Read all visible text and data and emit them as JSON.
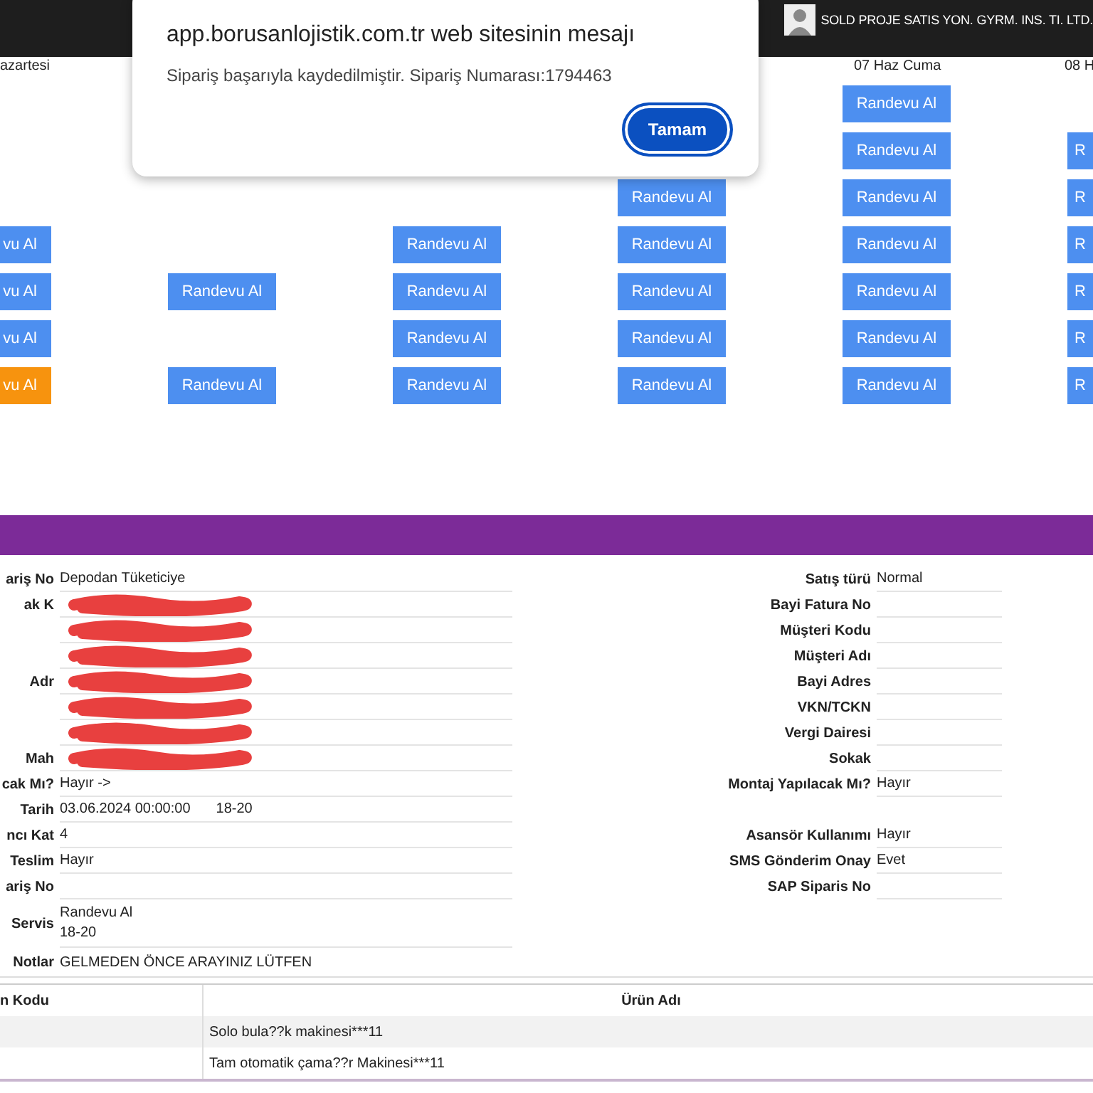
{
  "top_bar": {
    "user_name": "SOLD PROJE SATIS YON. GYRM. INS. TI. LTD."
  },
  "dialog": {
    "title": "app.borusanlojistik.com.tr web sitesinin mesajı",
    "message": "Sipariş başarıyla kaydedilmiştir. Sipariş Numarası:1794463",
    "button": "Tamam"
  },
  "calendar": {
    "days": [
      {
        "header": "azartesi",
        "slots": [
          {
            "kind": "empty"
          },
          {
            "kind": "empty"
          },
          {
            "kind": "empty"
          },
          {
            "kind": "button",
            "label": "vu Al",
            "selected": false
          },
          {
            "kind": "button",
            "label": "vu Al",
            "selected": false
          },
          {
            "kind": "button",
            "label": "vu Al",
            "selected": false
          },
          {
            "kind": "button",
            "label": "vu Al",
            "selected": true
          }
        ]
      },
      {
        "slots": [
          {
            "kind": "empty"
          },
          {
            "kind": "empty"
          },
          {
            "kind": "empty"
          },
          {
            "kind": "empty"
          },
          {
            "kind": "button",
            "label": "Randevu Al",
            "selected": false
          },
          {
            "kind": "empty"
          },
          {
            "kind": "button",
            "label": "Randevu Al",
            "selected": false
          }
        ]
      },
      {
        "slots": [
          {
            "kind": "empty"
          },
          {
            "kind": "empty"
          },
          {
            "kind": "empty"
          },
          {
            "kind": "button",
            "label": "Randevu Al",
            "selected": false
          },
          {
            "kind": "button",
            "label": "Randevu Al",
            "selected": false
          },
          {
            "kind": "button",
            "label": "Randevu Al",
            "selected": false
          },
          {
            "kind": "button",
            "label": "Randevu Al",
            "selected": false
          }
        ]
      },
      {
        "slots": [
          {
            "kind": "empty"
          },
          {
            "kind": "empty"
          },
          {
            "kind": "button",
            "label": "Randevu Al",
            "selected": false
          },
          {
            "kind": "button",
            "label": "Randevu Al",
            "selected": false
          },
          {
            "kind": "button",
            "label": "Randevu Al",
            "selected": false
          },
          {
            "kind": "button",
            "label": "Randevu Al",
            "selected": false
          },
          {
            "kind": "button",
            "label": "Randevu Al",
            "selected": false
          }
        ]
      },
      {
        "header": "07 Haz Cuma",
        "slots": [
          {
            "kind": "button",
            "label": "Randevu Al",
            "selected": false
          },
          {
            "kind": "button",
            "label": "Randevu Al",
            "selected": false
          },
          {
            "kind": "button",
            "label": "Randevu Al",
            "selected": false
          },
          {
            "kind": "button",
            "label": "Randevu Al",
            "selected": false
          },
          {
            "kind": "button",
            "label": "Randevu Al",
            "selected": false
          },
          {
            "kind": "button",
            "label": "Randevu Al",
            "selected": false
          },
          {
            "kind": "button",
            "label": "Randevu Al",
            "selected": false
          }
        ]
      },
      {
        "header": "08 H",
        "slots": [
          {
            "kind": "empty"
          },
          {
            "kind": "button",
            "label": "R",
            "selected": false
          },
          {
            "kind": "button",
            "label": "R",
            "selected": false
          },
          {
            "kind": "button",
            "label": "R",
            "selected": false
          },
          {
            "kind": "button",
            "label": "R",
            "selected": false
          },
          {
            "kind": "button",
            "label": "R",
            "selected": false
          },
          {
            "kind": "button",
            "label": "R",
            "selected": false
          }
        ]
      }
    ]
  },
  "order_form": {
    "left_fields": [
      {
        "label": "ariş No",
        "value": "Depodan Tüketiciye"
      },
      {
        "label": "ak K",
        "redacted": true
      },
      {
        "redacted": true
      },
      {
        "redacted": true
      },
      {
        "label": "Adr",
        "redacted": true
      },
      {
        "redacted": true
      },
      {
        "redacted": true
      },
      {
        "label": "Mah",
        "redacted": true
      },
      {
        "label": "cak Mı?",
        "value": "Hayır ->"
      },
      {
        "label": "Tarih",
        "value": "03.06.2024 00:00:00",
        "extra": "18-20"
      },
      {
        "label": "ncı Kat",
        "value": "4"
      },
      {
        "label": "Teslim",
        "value": "Hayır"
      },
      {
        "label": "ariş No"
      },
      {
        "label": "Servis",
        "value": "Randevu Al",
        "extra_line": "18-20"
      }
    ],
    "right_fields": [
      {
        "kind": "field",
        "label": "Satış türü",
        "value": "Normal"
      },
      {
        "kind": "field",
        "label": "Bayi Fatura No"
      },
      {
        "kind": "field",
        "label": "Müşteri Kodu"
      },
      {
        "kind": "field",
        "label": "Müşteri Adı"
      },
      {
        "kind": "field",
        "label": "Bayi Adres"
      },
      {
        "kind": "field",
        "label": "VKN/TCKN"
      },
      {
        "kind": "field",
        "label": "Vergi Dairesi"
      },
      {
        "kind": "field",
        "label": "Sokak"
      },
      {
        "kind": "field",
        "label": "Montaj Yapılacak Mı?",
        "value": "Hayır"
      },
      {
        "kind": "spacer"
      },
      {
        "kind": "field",
        "label": "Asansör Kullanımı",
        "value": "Hayır"
      },
      {
        "kind": "field",
        "label": "SMS Gönderim Onay",
        "value": "Evet"
      },
      {
        "kind": "field",
        "label": "SAP Siparis No"
      }
    ],
    "notes": {
      "label": "Notlar",
      "value": "GELMEDEN ÖNCE ARAYINIZ LÜTFEN"
    }
  },
  "products": {
    "columns": [
      "n Kodu",
      "Ürün Adı"
    ],
    "rows": [
      {
        "name": "Solo bula??k makinesi***11"
      },
      {
        "name": "Tam otomatik çama??r Makinesi***11"
      }
    ]
  }
}
